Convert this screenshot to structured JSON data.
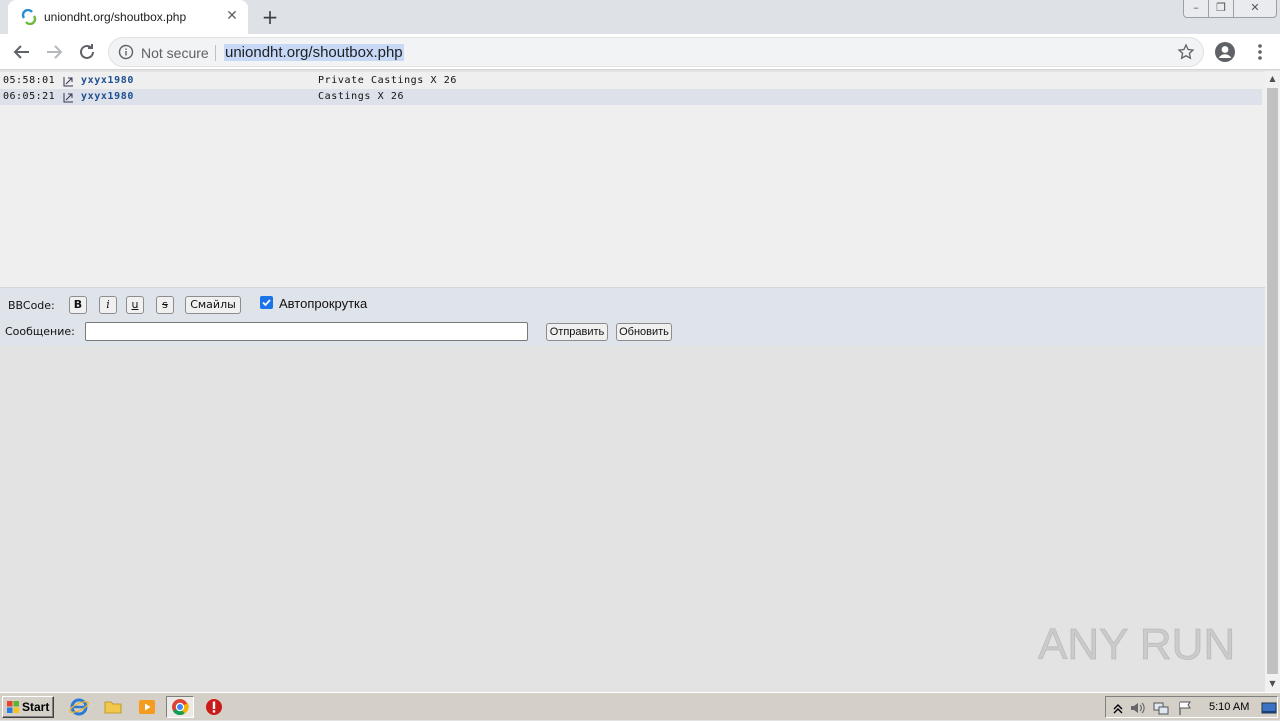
{
  "browser": {
    "tab": {
      "title": "uniondht.org/shoutbox.php",
      "close_glyph": "✕"
    },
    "new_tab_glyph": "+",
    "window_controls": {
      "minimize": "–",
      "maximize": "❐",
      "close": "✕"
    },
    "omnibox": {
      "security_label": "Not secure",
      "url": "uniondht.org/shoutbox.php"
    },
    "icons": [
      "back-icon",
      "forward-icon",
      "reload-icon",
      "info-icon",
      "star-icon",
      "profile-icon",
      "menu-icon"
    ]
  },
  "shoutbox": {
    "messages": [
      {
        "time": "05:58:01",
        "user": "yxyx1980",
        "text": "Private Castings X 26"
      },
      {
        "time": "06:05:21",
        "user": "yxyx1980",
        "text": "Castings X 26"
      }
    ]
  },
  "controls": {
    "bbcode_label": "BBCode:",
    "bold": "B",
    "italic": "i",
    "underline": "u",
    "strike": "s",
    "smiles_label": "Смайлы",
    "autoscroll_label": "Автопрокрутка",
    "autoscroll_checked": true,
    "message_label": "Сообщение:",
    "message_value": "",
    "send_label": "Отправить",
    "refresh_label": "Обновить"
  },
  "scrollbar": {
    "up": "▲",
    "down": "▼"
  },
  "watermark": {
    "text": "ANY RUN"
  },
  "taskbar": {
    "start_label": "Start",
    "clock": "5:10 AM",
    "pinned": [
      "ie-icon",
      "folder-icon",
      "media-player-icon",
      "chrome-icon",
      "stop-icon"
    ]
  },
  "colors": {
    "username": "#1e4f8f",
    "row_alt": "#dde2ea",
    "url_highlight": "#c8d9f7",
    "checkbox": "#1a73e8"
  }
}
